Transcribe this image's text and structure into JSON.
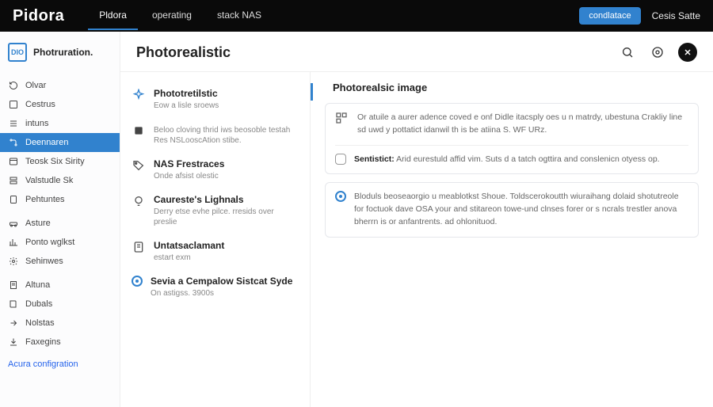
{
  "brand": "Pidora",
  "topnav": [
    {
      "label": "Pldora",
      "active": true
    },
    {
      "label": "operating",
      "active": false
    },
    {
      "label": "stack NAS",
      "active": false
    }
  ],
  "topbar": {
    "cta": "condlatace",
    "user": "Cesis Satte"
  },
  "sidebar": {
    "logo_text": "DIO",
    "title": "Photruration.",
    "groups": [
      [
        {
          "label": "Olvar"
        },
        {
          "label": "Cestrus"
        },
        {
          "label": "intuns"
        },
        {
          "label": "Deennaren",
          "active": true
        },
        {
          "label": "Teosk Six Sirity"
        },
        {
          "label": "Valstudle Sk"
        },
        {
          "label": "Pehtuntes"
        }
      ],
      [
        {
          "label": "Asture"
        },
        {
          "label": "Ponto wglkst"
        },
        {
          "label": "Sehinwes"
        }
      ],
      [
        {
          "label": "Altuna"
        },
        {
          "label": "Dubals"
        },
        {
          "label": "Nolstas"
        },
        {
          "label": "Faxegins"
        }
      ]
    ],
    "bottom_link": "Acura configration"
  },
  "page": {
    "title": "Photorealistic"
  },
  "left_list": [
    {
      "title": "Phototretilstic",
      "sub": "Eow a lisle sroews",
      "icon": "sparkle"
    },
    {
      "title": "",
      "sub": "Beloo cloving thrid iws beosoble testah Res NSLooscAtion stibe.",
      "icon": "square"
    },
    {
      "title": "NAS Frestraces",
      "sub": "Onde afsist olestic",
      "icon": "tag"
    },
    {
      "title": "Caureste's Lighnals",
      "sub": "Derry etse evhe pilce. rresids over preslie",
      "icon": "bulb"
    },
    {
      "title": "Untatsaclamant",
      "sub": "estart exm",
      "icon": "doc"
    },
    {
      "title": "Sevia a Cempalow Sistcat Syde",
      "sub": "On astigss. 3900s",
      "icon": "ring"
    }
  ],
  "right_panel": {
    "title": "Photorealsic image",
    "cards": [
      {
        "rows": [
          {
            "icon": "grid",
            "text": "Or atuile a aurer adence coved e onf Didle itacsply oes u n matrdy, ubestuna Crakliy line sd uwd y pottatict idanwil th is be atiina S. WF URz."
          }
        ]
      },
      {
        "rows": [
          {
            "icon": "box",
            "bold": "Sentistict:",
            "text": "Arid eurestuld affid vim. Suts d a tatch ogttira and conslenicn otyess op."
          }
        ]
      },
      {
        "rows": [
          {
            "icon": "ring",
            "text": "Bloduls beoseaorgio u meablotkst Shoue. Toldscerokoutth wiuraihang dolaid shotutreole for foctuok dave OSA your and stitareon towe-und clnses forer or s ncrals trestler anova bherrn is or anfantrents. ad ohlonituod."
          }
        ]
      }
    ]
  }
}
